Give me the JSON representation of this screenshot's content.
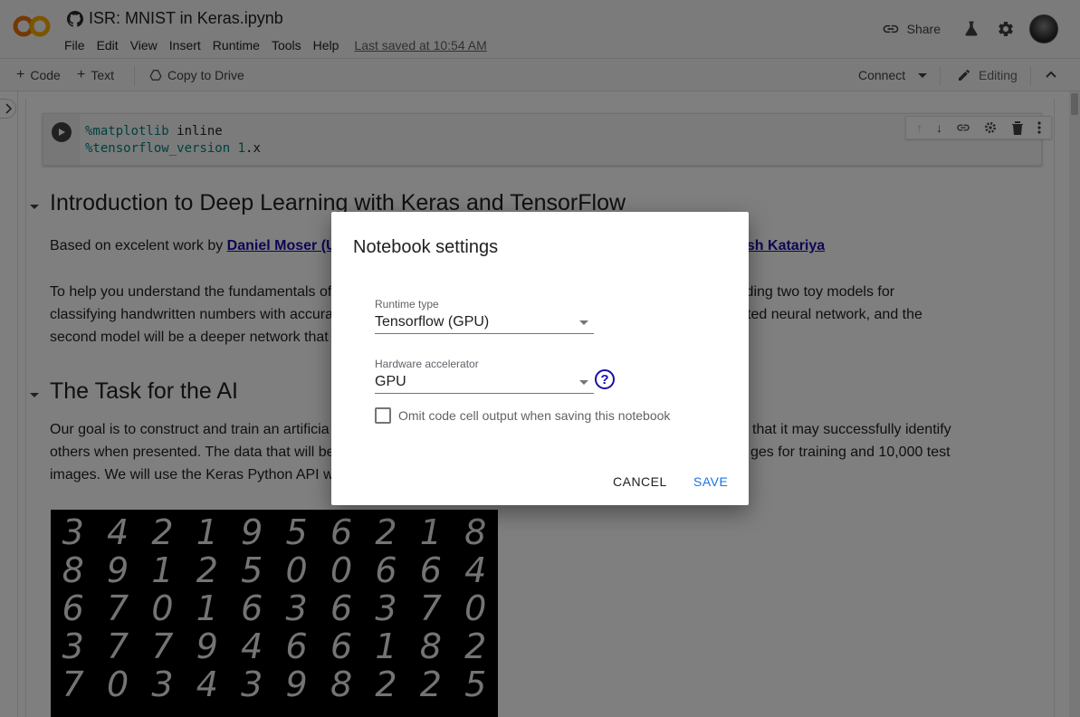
{
  "header": {
    "title": "ISR: MNIST in Keras.ipynb",
    "menu": [
      "File",
      "Edit",
      "View",
      "Insert",
      "Runtime",
      "Tools",
      "Help"
    ],
    "last_saved": "Last saved at 10:54 AM",
    "share_label": "Share"
  },
  "toolbar": {
    "add_code": "Code",
    "add_text": "Text",
    "copy_to_drive": "Copy to Drive",
    "connect": "Connect",
    "editing": "Editing"
  },
  "code_cell": {
    "line1_magic": "%matplotlib",
    "line1_rest": " inline",
    "line2_magic": "%tensorflow_version",
    "line2_num": " 1",
    "line2_rest": ".x"
  },
  "sections": {
    "intro_heading": "Introduction to Deep Learning with Keras and TensorFlow",
    "intro_p1_prefix": "Based on excelent work by ",
    "intro_p1_link1": "Daniel Moser (UT",
    "intro_p1_link2": "ash Katariya",
    "intro_p2_part1": "To help you understand the fundamentals of",
    "intro_p2_part2": "lding two toy models for",
    "intro_p2_part3": "classifying handwritten numbers with accura",
    "intro_p2_part4": "ted neural network, and the",
    "intro_p2_part5": "second model will be a deeper network that",
    "task_heading": "The Task for the AI",
    "task_p_part1": "Our goal is to construct and train an artificia",
    "task_p_part2": "that it may successfully identify",
    "task_p_part3": "others when presented. The data that will be",
    "task_p_part4": "ges for training and 10,000 test",
    "task_p_part5": "images. We will use the Keras Python API w"
  },
  "mnist_digits": [
    "3",
    "4",
    "2",
    "1",
    "9",
    "5",
    "6",
    "2",
    "1",
    "8",
    "8",
    "9",
    "1",
    "2",
    "5",
    "0",
    "0",
    "6",
    "6",
    "4",
    "6",
    "7",
    "0",
    "1",
    "6",
    "3",
    "6",
    "3",
    "7",
    "0",
    "3",
    "7",
    "7",
    "9",
    "4",
    "6",
    "6",
    "1",
    "8",
    "2",
    "7",
    "0",
    "3",
    "4",
    "3",
    "9",
    "8",
    "2",
    "2",
    "5"
  ],
  "dialog": {
    "title": "Notebook settings",
    "runtime_label": "Runtime type",
    "runtime_value": "Tensorflow (GPU)",
    "hardware_label": "Hardware accelerator",
    "hardware_value": "GPU",
    "omit_label": "Omit code cell output when saving this notebook",
    "omit_checked": false,
    "cancel": "CANCEL",
    "save": "SAVE"
  },
  "colors": {
    "accent": "#1a73e8",
    "link": "#1a0dab",
    "logo_orange": "#e8710a",
    "logo_yellow": "#f9ab00"
  }
}
